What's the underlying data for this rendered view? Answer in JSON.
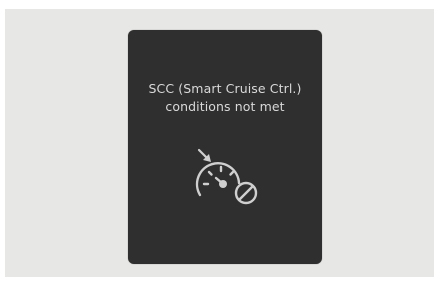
{
  "cluster_message": {
    "line1": "SCC (Smart Cruise Ctrl.)",
    "line2": "conditions not met",
    "icon": "smart-cruise-control-unavailable-icon"
  },
  "colors": {
    "panel_background": "#2f2f2f",
    "text": "#d9d9d9",
    "icon": "#cfcfcf",
    "page_background": "#e7e7e5"
  }
}
